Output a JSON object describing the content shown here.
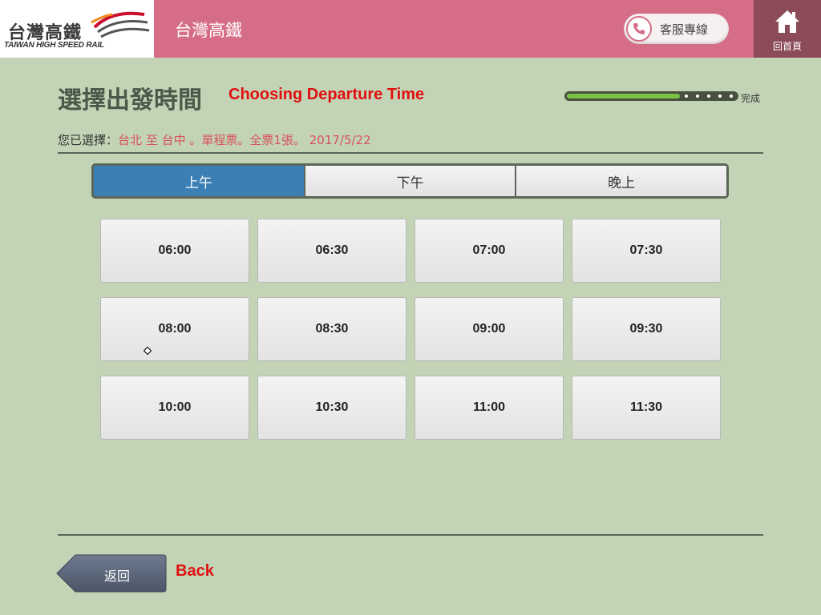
{
  "header": {
    "logo_zh": "台灣高鐵",
    "logo_en": "TAIWAN HIGH SPEED RAIL",
    "title": "台灣高鐵",
    "service_label": "客服專線",
    "service_icon": "phone-icon",
    "home_label": "回首頁",
    "home_icon": "home-icon",
    "colors": {
      "bar": "#d66d86",
      "home": "#8c4b59"
    }
  },
  "page": {
    "title_zh": "選擇出發時間",
    "title_en": "Choosing Departure Time",
    "progress_label": "完成",
    "progress_fraction": 0.67
  },
  "selection": {
    "prefix": "您已選擇：",
    "from": "台北",
    "to_word": "至",
    "to": "台中",
    "details": "。單程票。全票1張。",
    "date": "2017/5/22"
  },
  "tabs": [
    {
      "label": "上午",
      "active": true
    },
    {
      "label": "下午",
      "active": false
    },
    {
      "label": "晚上",
      "active": false
    }
  ],
  "times": [
    "06:00",
    "06:30",
    "07:00",
    "07:30",
    "08:00",
    "08:30",
    "09:00",
    "09:30",
    "10:00",
    "10:30",
    "11:00",
    "11:30"
  ],
  "footer": {
    "back_label": "返回",
    "back_en": "Back"
  },
  "colors": {
    "background": "#c3d4b6",
    "accent_red": "#e01010",
    "active_tab": "#3b7fb5",
    "progress": "#7ac142"
  }
}
